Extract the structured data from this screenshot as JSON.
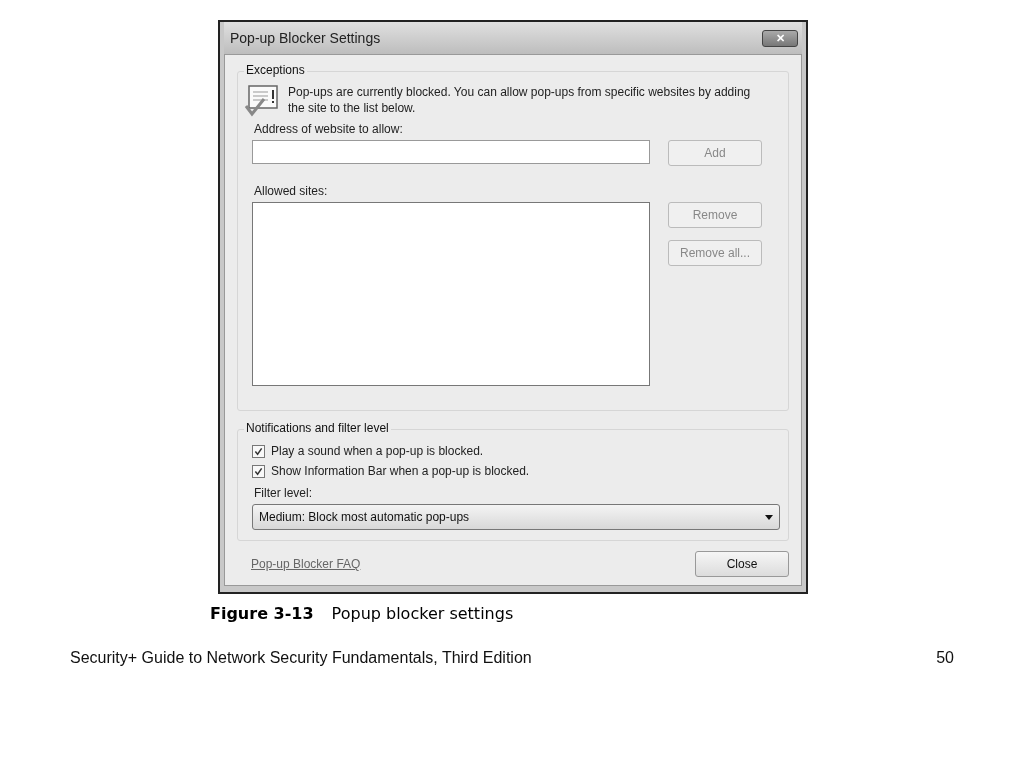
{
  "window": {
    "title": "Pop-up Blocker Settings",
    "close_label": "✕"
  },
  "exceptions": {
    "title": "Exceptions",
    "message": "Pop-ups are currently blocked.  You can allow pop-ups from specific websites by adding the site to the list below.",
    "address_label": "Address of website to allow:",
    "add_button": {
      "label": "Add",
      "disabled": true
    },
    "allowed_label": "Allowed sites:",
    "buttons": [
      {
        "label": "Remove",
        "disabled": true
      },
      {
        "label": "Remove all...",
        "disabled": true
      }
    ]
  },
  "notifications": {
    "title": "Notifications and filter level",
    "checkboxes": [
      {
        "label": "Play a sound when a pop-up is blocked.",
        "checked": true
      },
      {
        "label": "Show Information Bar when a pop-up is blocked.",
        "checked": true
      }
    ],
    "filter_label": "Filter level:",
    "filter_value": "Medium: Block most automatic pop-ups"
  },
  "footer": {
    "link": "Pop-up Blocker FAQ",
    "close_button": {
      "label": "Close",
      "disabled": false
    }
  },
  "caption": {
    "number": "Figure 3-13",
    "text": "Popup blocker settings"
  },
  "slide_footer": {
    "text": "Security+ Guide to Network Security Fundamentals, Third Edition",
    "page": "50"
  }
}
